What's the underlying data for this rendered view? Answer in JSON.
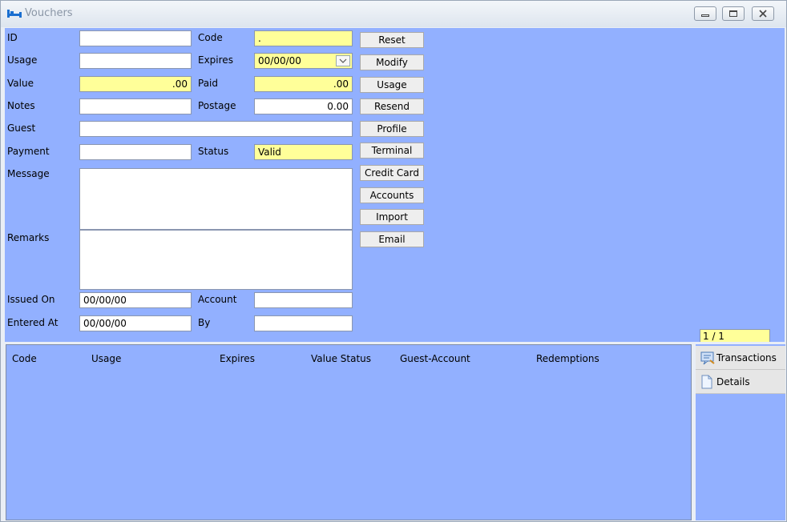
{
  "window": {
    "title": "Vouchers"
  },
  "form": {
    "labels": {
      "id": "ID",
      "usage": "Usage",
      "value": "Value",
      "notes": "Notes",
      "guest": "Guest",
      "payment": "Payment",
      "message": "Message",
      "remarks": "Remarks",
      "issued_on": "Issued On",
      "entered_at": "Entered At",
      "code": "Code",
      "expires": "Expires",
      "paid": "Paid",
      "postage": "Postage",
      "status": "Status",
      "account": "Account",
      "by": "By"
    },
    "values": {
      "id": "",
      "usage": "",
      "value": ".00",
      "notes": "",
      "guest": "",
      "payment": "",
      "message": "",
      "remarks": "",
      "issued_on": "00/00/00",
      "entered_at": "00/00/00",
      "code": ".",
      "expires": "00/00/00",
      "paid": ".00",
      "postage": "0.00",
      "status": "Valid",
      "account": "",
      "by": ""
    }
  },
  "buttons": [
    "Reset",
    "Modify",
    "Usage",
    "Resend",
    "Profile",
    "Terminal",
    "Credit Card",
    "Accounts",
    "Import",
    "Email"
  ],
  "pager": "1 / 1",
  "grid": {
    "columns": [
      "Code",
      "Usage",
      "Expires",
      "Value Status",
      "Guest-Account",
      "Redemptions"
    ]
  },
  "side_tabs": {
    "transactions": "Transactions",
    "details": "Details"
  },
  "colors": {
    "panel": "#92b0ff",
    "highlight_field": "#ffff99",
    "button": "#eeeeee"
  }
}
